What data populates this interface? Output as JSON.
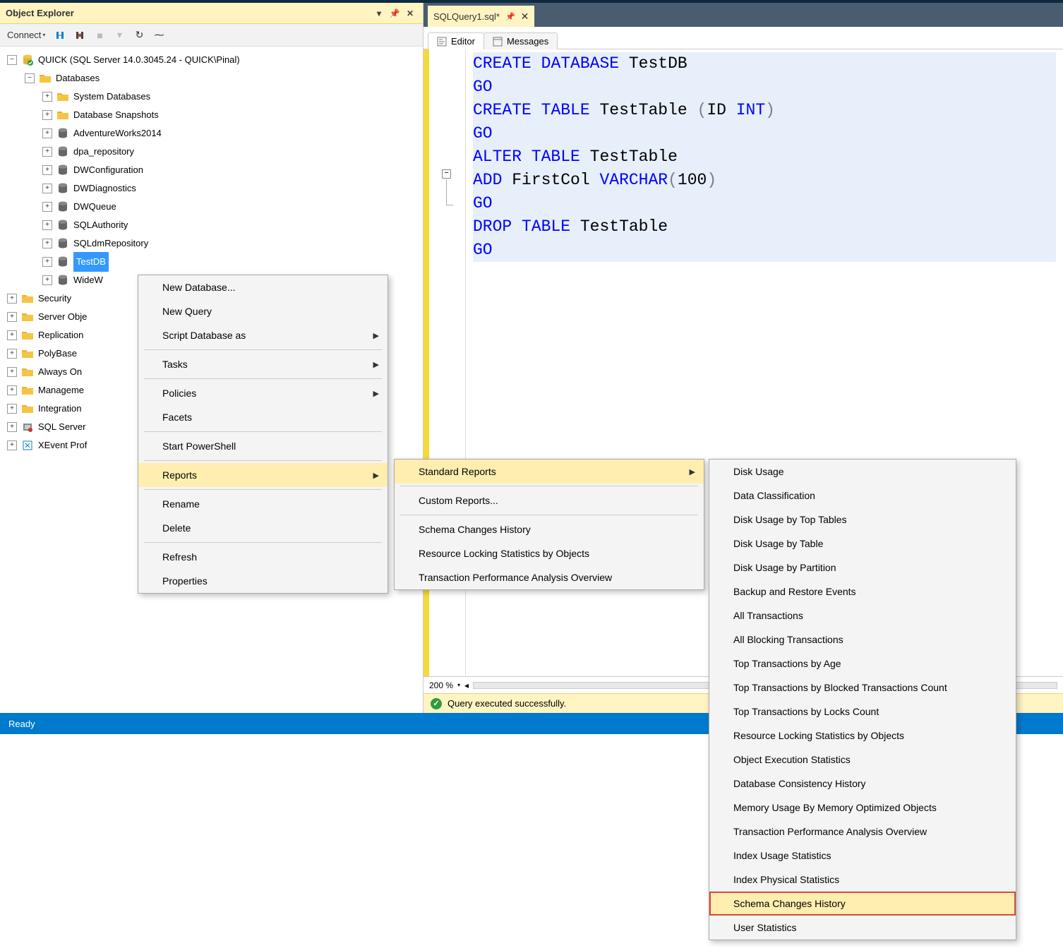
{
  "object_explorer": {
    "title": "Object Explorer",
    "toolbar": {
      "connect": "Connect"
    },
    "tree": {
      "server": "QUICK (SQL Server 14.0.3045.24 - QUICK\\Pinal)",
      "databases_node": "Databases",
      "db_folders": [
        "System Databases",
        "Database Snapshots"
      ],
      "db_items": [
        "AdventureWorks2014",
        "dpa_repository",
        "DWConfiguration",
        "DWDiagnostics",
        "DWQueue",
        "SQLAuthority",
        "SQLdmRepository",
        "TestDB",
        "WideW"
      ],
      "top_nodes": [
        "Security",
        "Server Obje",
        "Replication",
        "PolyBase",
        "Always On",
        "Manageme",
        "Integration",
        "SQL Server",
        "XEvent Prof"
      ]
    }
  },
  "editor": {
    "tab_title": "SQLQuery1.sql*",
    "inner_tabs": {
      "editor": "Editor",
      "messages": "Messages"
    },
    "code_lines": [
      {
        "tokens": [
          [
            "kw",
            "CREATE"
          ],
          [
            "sp",
            " "
          ],
          [
            "kw",
            "DATABASE"
          ],
          [
            "sp",
            " "
          ],
          [
            "ident",
            "TestDB"
          ]
        ],
        "sel": true
      },
      {
        "tokens": [
          [
            "kw",
            "GO"
          ]
        ],
        "sel": true
      },
      {
        "tokens": [
          [
            "kw",
            "CREATE"
          ],
          [
            "sp",
            " "
          ],
          [
            "kw",
            "TABLE"
          ],
          [
            "sp",
            " "
          ],
          [
            "ident",
            "TestTable"
          ],
          [
            "sp",
            " "
          ],
          [
            "gray",
            "("
          ],
          [
            "ident",
            "ID"
          ],
          [
            "sp",
            " "
          ],
          [
            "kw",
            "INT"
          ],
          [
            "gray",
            ")"
          ]
        ],
        "sel": true
      },
      {
        "tokens": [
          [
            "kw",
            "GO"
          ]
        ],
        "sel": true
      },
      {
        "tokens": [
          [
            "kw",
            "ALTER"
          ],
          [
            "sp",
            " "
          ],
          [
            "kw",
            "TABLE"
          ],
          [
            "sp",
            " "
          ],
          [
            "ident",
            "TestTable"
          ]
        ],
        "sel": true
      },
      {
        "tokens": [
          [
            "kw",
            "ADD"
          ],
          [
            "sp",
            " "
          ],
          [
            "ident",
            "FirstCol"
          ],
          [
            "sp",
            " "
          ],
          [
            "kw",
            "VARCHAR"
          ],
          [
            "gray",
            "("
          ],
          [
            "ident",
            "100"
          ],
          [
            "gray",
            ")"
          ]
        ],
        "sel": true
      },
      {
        "tokens": [
          [
            "kw",
            "GO"
          ]
        ],
        "sel": true
      },
      {
        "tokens": [
          [
            "kw",
            "DROP"
          ],
          [
            "sp",
            " "
          ],
          [
            "kw",
            "TABLE"
          ],
          [
            "sp",
            " "
          ],
          [
            "ident",
            "TestTable"
          ]
        ],
        "sel": true
      },
      {
        "tokens": [
          [
            "kw",
            "GO"
          ]
        ],
        "sel": true
      }
    ],
    "zoom": "200 %",
    "status": "Query executed successfully."
  },
  "ready": "Ready",
  "context_menu_1": [
    {
      "t": "item",
      "label": "New Database..."
    },
    {
      "t": "item",
      "label": "New Query"
    },
    {
      "t": "item",
      "label": "Script Database as",
      "sub": true
    },
    {
      "t": "sep"
    },
    {
      "t": "item",
      "label": "Tasks",
      "sub": true
    },
    {
      "t": "sep"
    },
    {
      "t": "item",
      "label": "Policies",
      "sub": true
    },
    {
      "t": "item",
      "label": "Facets"
    },
    {
      "t": "sep"
    },
    {
      "t": "item",
      "label": "Start PowerShell"
    },
    {
      "t": "sep"
    },
    {
      "t": "item",
      "label": "Reports",
      "sub": true,
      "hover": true
    },
    {
      "t": "sep"
    },
    {
      "t": "item",
      "label": "Rename"
    },
    {
      "t": "item",
      "label": "Delete"
    },
    {
      "t": "sep"
    },
    {
      "t": "item",
      "label": "Refresh"
    },
    {
      "t": "item",
      "label": "Properties"
    }
  ],
  "context_menu_2": [
    {
      "t": "item",
      "label": "Standard Reports",
      "sub": true,
      "hover": true
    },
    {
      "t": "sep"
    },
    {
      "t": "item",
      "label": "Custom Reports..."
    },
    {
      "t": "sep"
    },
    {
      "t": "item",
      "label": "Schema Changes History"
    },
    {
      "t": "item",
      "label": "Resource Locking Statistics by Objects"
    },
    {
      "t": "item",
      "label": "Transaction Performance Analysis Overview"
    }
  ],
  "context_menu_3": [
    {
      "t": "item",
      "label": "Disk Usage"
    },
    {
      "t": "item",
      "label": "Data Classification"
    },
    {
      "t": "item",
      "label": "Disk Usage by Top Tables"
    },
    {
      "t": "item",
      "label": "Disk Usage by Table"
    },
    {
      "t": "item",
      "label": "Disk Usage by Partition"
    },
    {
      "t": "item",
      "label": "Backup and Restore Events"
    },
    {
      "t": "item",
      "label": "All Transactions"
    },
    {
      "t": "item",
      "label": "All Blocking Transactions"
    },
    {
      "t": "item",
      "label": "Top Transactions by Age"
    },
    {
      "t": "item",
      "label": "Top Transactions by Blocked Transactions Count"
    },
    {
      "t": "item",
      "label": "Top Transactions by Locks Count"
    },
    {
      "t": "item",
      "label": "Resource Locking Statistics by Objects"
    },
    {
      "t": "item",
      "label": "Object Execution Statistics"
    },
    {
      "t": "item",
      "label": "Database Consistency History"
    },
    {
      "t": "item",
      "label": "Memory Usage By Memory Optimized Objects"
    },
    {
      "t": "item",
      "label": "Transaction Performance Analysis Overview"
    },
    {
      "t": "item",
      "label": "Index Usage Statistics"
    },
    {
      "t": "item",
      "label": "Index Physical Statistics"
    },
    {
      "t": "item",
      "label": "Schema Changes History",
      "hl": true
    },
    {
      "t": "item",
      "label": "User Statistics"
    }
  ]
}
